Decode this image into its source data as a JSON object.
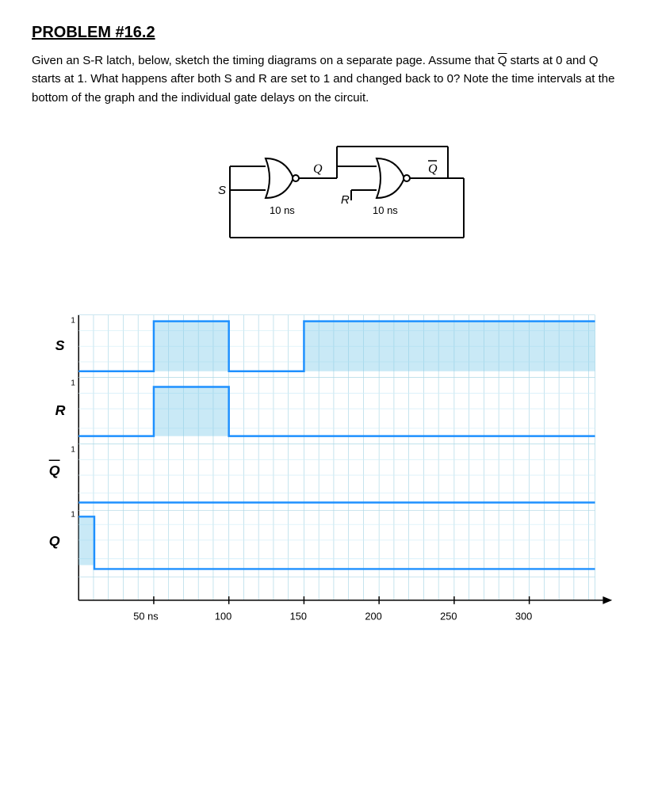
{
  "title": "PROBLEM #16.2",
  "problem_text": {
    "line1": "Given an S-R latch, below, sketch the timing diagrams on a",
    "line2": "separate page. Assume that",
    "q_bar": "Q",
    "line2b": "starts at 0 and Q starts at 1.",
    "line3": "What happens after both S and R are set to 1 and changed",
    "line4": "back to 0? Note the time intervals at the bottom of the graph",
    "line5": "and the individual gate delays on the circuit."
  },
  "circuit": {
    "gate1_delay": "10 ns",
    "gate2_delay": "10 ns",
    "label_S": "S",
    "label_R": "R",
    "label_Q": "Q",
    "label_Q_bar": "Q"
  },
  "timing": {
    "signals": [
      "S",
      "R",
      "Q_bar",
      "Q"
    ],
    "time_labels": [
      "50 ns",
      "100",
      "150",
      "200",
      "250",
      "300"
    ]
  }
}
